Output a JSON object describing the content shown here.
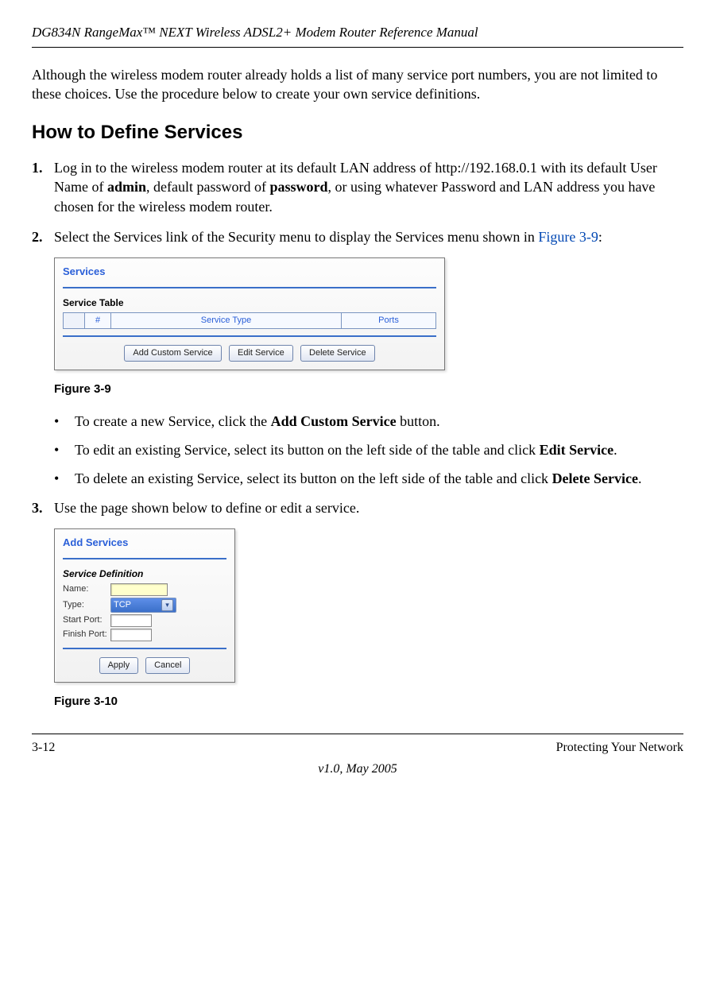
{
  "header": {
    "title": "DG834N RangeMax™ NEXT Wireless ADSL2+ Modem Router Reference Manual"
  },
  "intro_para": "Although the wireless modem router already holds a list of many service port numbers, you are not limited to these choices. Use the procedure below to create your own service definitions.",
  "heading": "How to Define Services",
  "steps": {
    "s1": {
      "num": "1.",
      "pre": "Log in to the wireless modem router at its default LAN address of http://192.168.0.1 with its default User Name of ",
      "admin": "admin",
      "mid1": ", default password of ",
      "password": "password",
      "post": ", or using whatever Password and LAN address you have chosen for the wireless modem router."
    },
    "s2": {
      "num": "2.",
      "text": "Select the Services link of the Security menu to display the Services menu shown in ",
      "linkref": "Figure 3-9",
      "after": ":"
    },
    "s3": {
      "num": "3.",
      "text": "Use the page shown below to define or edit a service."
    }
  },
  "fig1": {
    "title": "Services",
    "sub": "Service Table",
    "th_num": "#",
    "th_type": "Service Type",
    "th_ports": "Ports",
    "btn_add": "Add Custom Service",
    "btn_edit": "Edit Service",
    "btn_delete": "Delete Service",
    "caption": "Figure 3-9"
  },
  "bullets": {
    "b1": {
      "pre": "To create a new Service, click the ",
      "bold": "Add Custom Service",
      "post": " button."
    },
    "b2": {
      "pre": "To edit an existing Service, select its button on the left side of the table and click ",
      "bold": "Edit Service",
      "post": "."
    },
    "b3": {
      "pre": "To delete an existing Service, select its button on the left side of the table and click ",
      "bold": "Delete Service",
      "post": "."
    }
  },
  "fig2": {
    "title": "Add Services",
    "sub": "Service Definition",
    "lbl_name": "Name:",
    "lbl_type": "Type:",
    "type_val": "TCP",
    "lbl_start": "Start Port:",
    "lbl_finish": "Finish Port:",
    "btn_apply": "Apply",
    "btn_cancel": "Cancel",
    "caption": "Figure 3-10"
  },
  "footer": {
    "left": "3-12",
    "right": "Protecting Your Network",
    "center": "v1.0, May 2005"
  }
}
